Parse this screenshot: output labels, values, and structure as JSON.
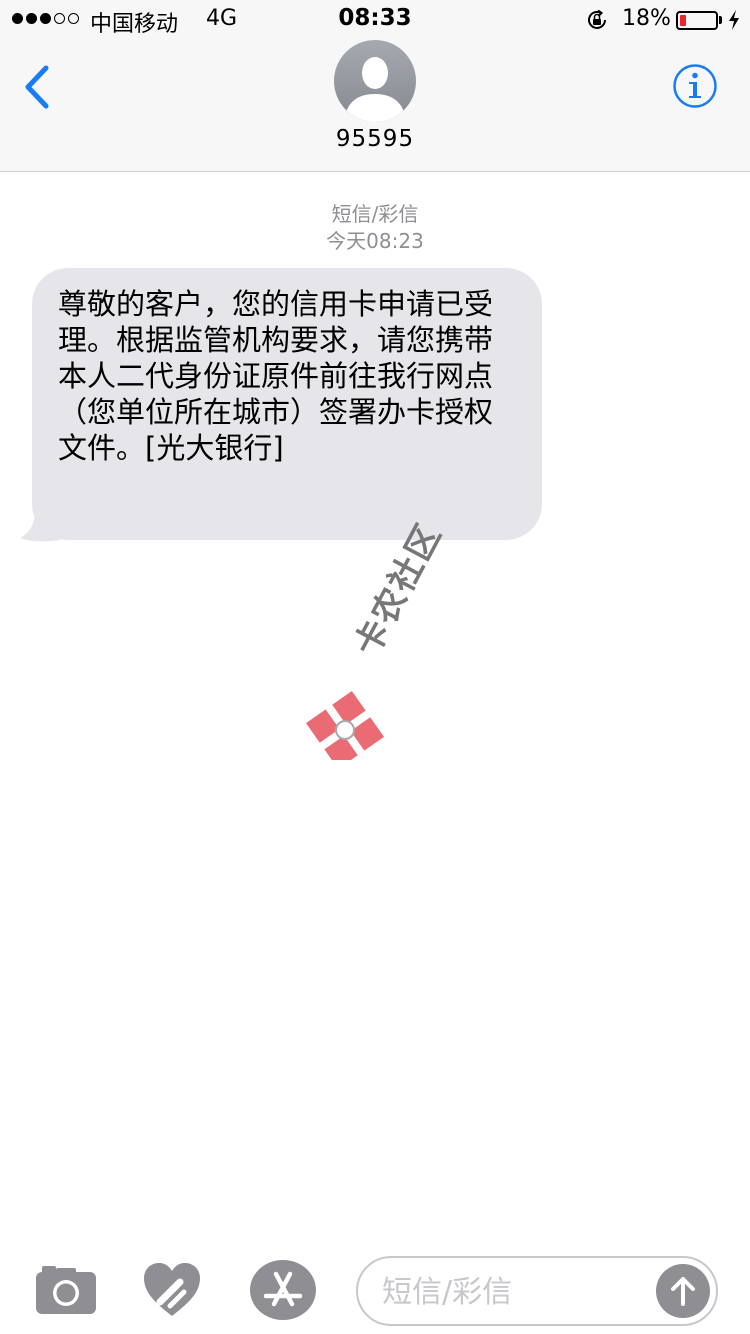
{
  "status_bar": {
    "signal_dots_filled": 3,
    "signal_dots_total": 5,
    "carrier": "中国移动",
    "network": "4G",
    "time": "08:33",
    "orientation_lock_icon": "orientation-lock-icon",
    "battery_percent_text": "18%",
    "battery_level": 0.18,
    "battery_color": "#e8262b",
    "charging_icon": "bolt-icon"
  },
  "header": {
    "back_icon": "chevron-left-icon",
    "avatar_icon": "person-silhouette-icon",
    "contact": "95595",
    "info_icon": "info-icon",
    "accent_color": "#1a7cf5"
  },
  "conversation": {
    "message_type": "短信/彩信",
    "timestamp": "今天08:23",
    "messages": [
      {
        "direction": "incoming",
        "text": "尊敬的客户，您的信用卡申请已受理。根据监管机构要求，请您携带本人二代身份证原件前往我行网点（您单位所在城市）签署办卡授权文件。[光大银行]"
      }
    ],
    "bubble_color": "#e5e5ea"
  },
  "watermark": {
    "text": "卡农社区",
    "logo_color": "#e8525e"
  },
  "input_bar": {
    "camera_icon": "camera-icon",
    "digital_touch_icon": "digital-touch-heart-icon",
    "app_store_icon": "app-store-icon",
    "placeholder": "短信/彩信",
    "send_icon": "arrow-up-icon"
  }
}
